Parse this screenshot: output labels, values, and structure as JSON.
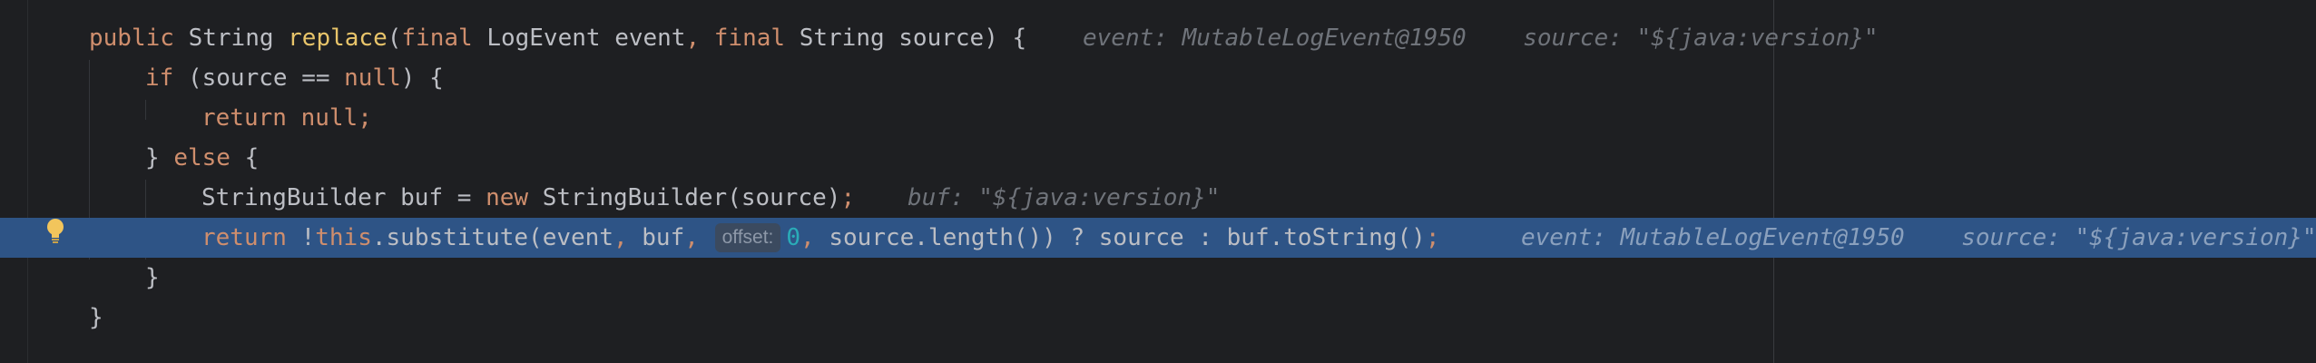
{
  "editor": {
    "lines": [
      {
        "tokens": [
          {
            "t": "public ",
            "c": "kw"
          },
          {
            "t": "String ",
            "c": "pl"
          },
          {
            "t": "replace",
            "c": "meth"
          },
          {
            "t": "(",
            "c": "pl"
          },
          {
            "t": "final ",
            "c": "kw"
          },
          {
            "t": "LogEvent event",
            "c": "pl"
          },
          {
            "t": ", ",
            "c": "kw"
          },
          {
            "t": "final ",
            "c": "kw"
          },
          {
            "t": "String source) {",
            "c": "pl"
          }
        ],
        "hint": "event: MutableLogEvent@1950    source: \"${java:version}\""
      },
      {
        "tokens": [
          {
            "t": "if ",
            "c": "kw"
          },
          {
            "t": "(source == ",
            "c": "pl"
          },
          {
            "t": "null",
            "c": "kw"
          },
          {
            "t": ") {",
            "c": "pl"
          }
        ],
        "hint": ""
      },
      {
        "tokens": [
          {
            "t": "return null",
            "c": "kw"
          },
          {
            "t": ";",
            "c": "kw"
          }
        ],
        "hint": ""
      },
      {
        "tokens": [
          {
            "t": "} ",
            "c": "pl"
          },
          {
            "t": "else ",
            "c": "kw"
          },
          {
            "t": "{",
            "c": "pl"
          }
        ],
        "hint": ""
      },
      {
        "tokens": [
          {
            "t": "StringBuilder buf = ",
            "c": "pl"
          },
          {
            "t": "new ",
            "c": "kw"
          },
          {
            "t": "StringBuilder(source)",
            "c": "pl"
          },
          {
            "t": ";",
            "c": "kw"
          }
        ],
        "hint": "buf: \"${java:version}\""
      },
      {
        "tokens": [
          {
            "t": "return ",
            "c": "kw"
          },
          {
            "t": "!",
            "c": "pl"
          },
          {
            "t": "this",
            "c": "kw"
          },
          {
            "t": ".substitute(event",
            "c": "pl"
          },
          {
            "t": ", ",
            "c": "kw"
          },
          {
            "t": "buf",
            "c": "pl"
          },
          {
            "t": ", ",
            "c": "kw"
          }
        ],
        "param_hint": "offset:",
        "tokens_after": [
          {
            "t": "0",
            "c": "num"
          },
          {
            "t": ", ",
            "c": "kw"
          },
          {
            "t": "source.length()) ? source : buf.toString()",
            "c": "pl"
          },
          {
            "t": ";",
            "c": "kw"
          }
        ],
        "hint": "event: MutableLogEvent@1950    source: \"${java:version}\""
      },
      {
        "tokens": [
          {
            "t": "}",
            "c": "pl"
          }
        ],
        "hint": ""
      },
      {
        "tokens": [
          {
            "t": "}",
            "c": "pl"
          }
        ],
        "hint": ""
      }
    ],
    "execution_line_index": 5,
    "gutter_icon": "lightbulb-icon",
    "colors": {
      "background": "#1e1f22",
      "execution_highlight": "#2e5486",
      "keyword": "#cf8e6d",
      "method": "#e8c46a",
      "text": "#bcbec4",
      "number": "#2aacb8",
      "inline_hint": "#6f737a",
      "bulb": "#f2c55c"
    }
  }
}
